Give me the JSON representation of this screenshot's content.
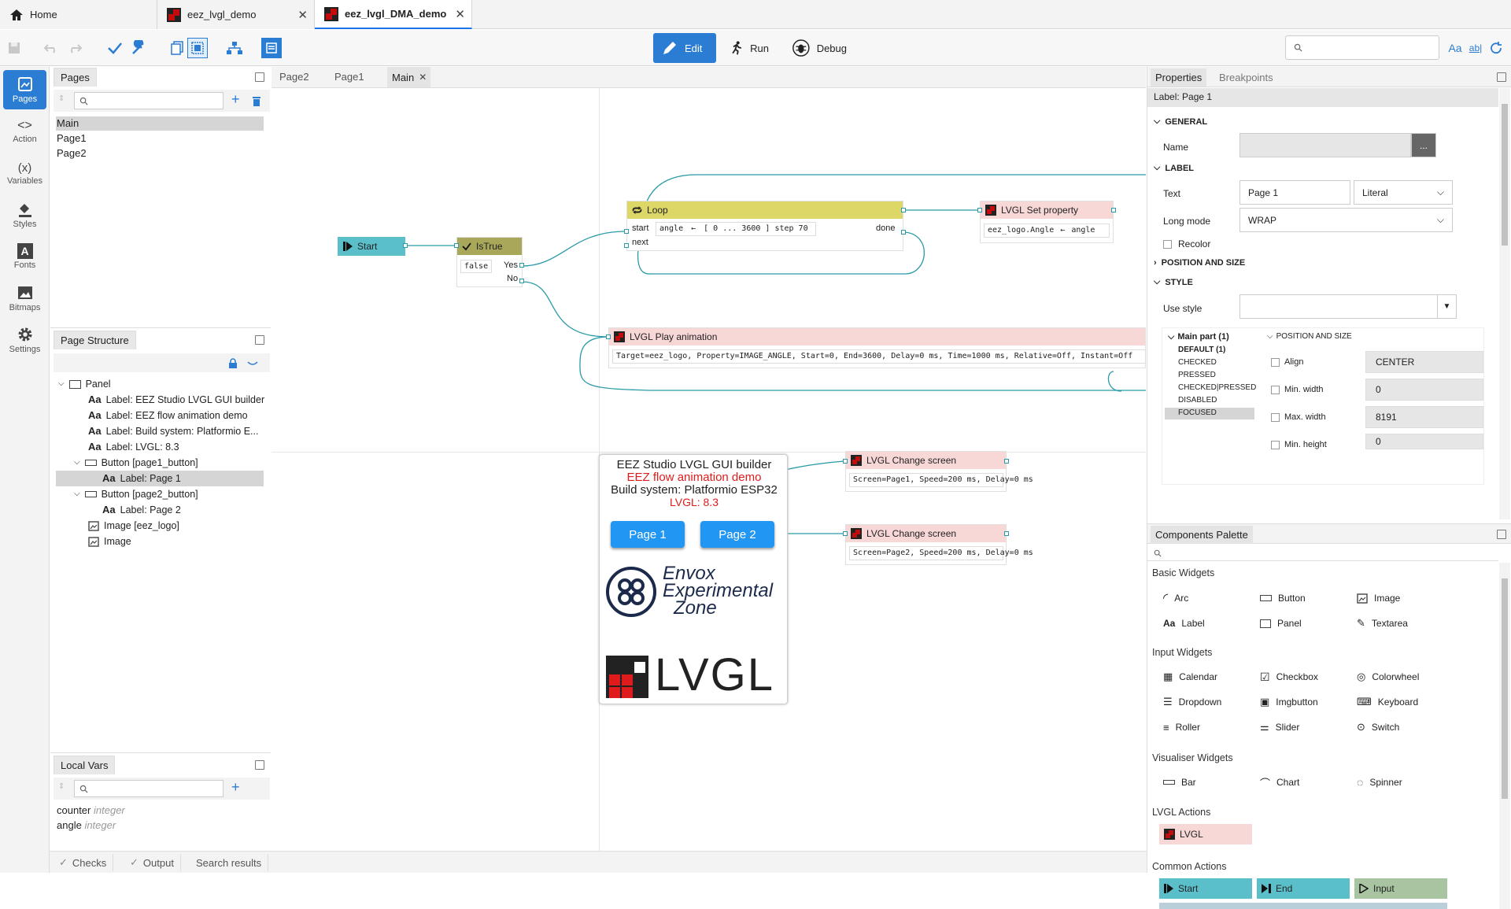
{
  "tabs": {
    "home": "Home",
    "tab1": "eez_lvgl_demo",
    "tab2": "eez_lvgl_DMA_demo"
  },
  "toolbar": {
    "edit": "Edit",
    "run": "Run",
    "debug": "Debug"
  },
  "leftnav": {
    "pages": "Pages",
    "action": "Action",
    "variables": "Variables",
    "styles": "Styles",
    "fonts": "Fonts",
    "bitmaps": "Bitmaps",
    "settings": "Settings"
  },
  "pages_panel": {
    "title": "Pages",
    "items": [
      "Main",
      "Page1",
      "Page2"
    ]
  },
  "structure": {
    "title": "Page Structure",
    "items": [
      "Panel",
      "Label: EEZ Studio LVGL GUI builder",
      "Label: EEZ flow animation demo",
      "Label: Build system: Platformio E...",
      "Label: LVGL: 8.3",
      "Button [page1_button]",
      "Label: Page 1",
      "Button [page2_button]",
      "Label: Page 2",
      "Image [eez_logo]",
      "Image"
    ]
  },
  "localvars": {
    "title": "Local Vars",
    "vars": [
      {
        "name": "counter",
        "type": "integer"
      },
      {
        "name": "angle",
        "type": "integer"
      }
    ]
  },
  "editor_tabs": [
    "Page2",
    "Page1",
    "Main"
  ],
  "flow": {
    "start": "Start",
    "istrue": "IsTrue",
    "istrue_value": "false",
    "yes": "Yes",
    "no": "No",
    "loop": "Loop",
    "loop_start": "start",
    "loop_next": "next",
    "loop_done": "done",
    "loop_var": "angle",
    "loop_arrow": "←",
    "loop_range": "[ 0 ... 3600 ] step 70",
    "setprop": "LVGL Set property",
    "setprop_target": "eez_logo.Angle",
    "setprop_value": "angle",
    "play": "LVGL Play animation",
    "play_params": "Target=eez_logo, Property=IMAGE_ANGLE, Start=0, End=3600, Delay=0 ms, Time=1000 ms, Relative=Off, Instant=Off",
    "change1": "LVGL Change screen",
    "change1_params": "Screen=Page1, Speed=200 ms, Delay=0 ms",
    "change2": "LVGL Change screen",
    "change2_params": "Screen=Page2, Speed=200 ms, Delay=0 ms"
  },
  "preview": {
    "line1": "EEZ Studio LVGL GUI builder",
    "line2": "EEZ flow animation demo",
    "line3": "Build system: Platformio ESP32",
    "line4": "LVGL: 8.3",
    "btn1": "Page 1",
    "btn2": "Page 2",
    "envox1": "Envox",
    "envox2": "Experimental",
    "envox3": "Zone",
    "lvgl": "LVGL"
  },
  "properties": {
    "tab_props": "Properties",
    "tab_bp": "Breakpoints",
    "selected": "Label: Page 1",
    "general": "GENERAL",
    "name_label": "Name",
    "name_btn": "...",
    "label_sect": "LABEL",
    "text_label": "Text",
    "text_value": "Page 1",
    "text_type": "Literal",
    "longmode_label": "Long mode",
    "longmode_value": "WRAP",
    "recolor": "Recolor",
    "possize": "POSITION AND SIZE",
    "style": "STYLE",
    "use_style": "Use style",
    "main_part": "Main part (1)",
    "states": [
      "DEFAULT (1)",
      "CHECKED",
      "PRESSED",
      "CHECKED|PRESSED",
      "DISABLED",
      "FOCUSED"
    ],
    "possize2": "POSITION AND SIZE",
    "align_label": "Align",
    "align_value": "CENTER",
    "minw_label": "Min. width",
    "minw_value": "0",
    "maxw_label": "Max. width",
    "maxw_value": "8191",
    "minh_label": "Min. height",
    "minh_value": "0"
  },
  "palette": {
    "title": "Components Palette",
    "basic": "Basic Widgets",
    "basic_items": [
      "Arc",
      "Button",
      "Image",
      "Label",
      "Panel",
      "Textarea"
    ],
    "input": "Input Widgets",
    "input_items": [
      "Calendar",
      "Checkbox",
      "Colorwheel",
      "Dropdown",
      "Imgbutton",
      "Keyboard",
      "Roller",
      "Slider",
      "Switch"
    ],
    "visual": "Visualiser Widgets",
    "visual_items": [
      "Bar",
      "Chart",
      "Spinner"
    ],
    "lvgl_actions": "LVGL Actions",
    "lvgl_item": "LVGL",
    "common": "Common Actions",
    "common_items": [
      "Start",
      "End",
      "Input"
    ]
  },
  "bottom": {
    "checks": "Checks",
    "output": "Output",
    "search": "Search results"
  },
  "colors": {
    "accent": "#2b7cd3",
    "flow_line": "#2b9aa8",
    "start_node": "#5bbfc9",
    "istrue_node": "#a9a85a",
    "loop_node": "#dcd766",
    "lvgl_node": "#f8d7d7",
    "red_text": "#e01b1b"
  }
}
